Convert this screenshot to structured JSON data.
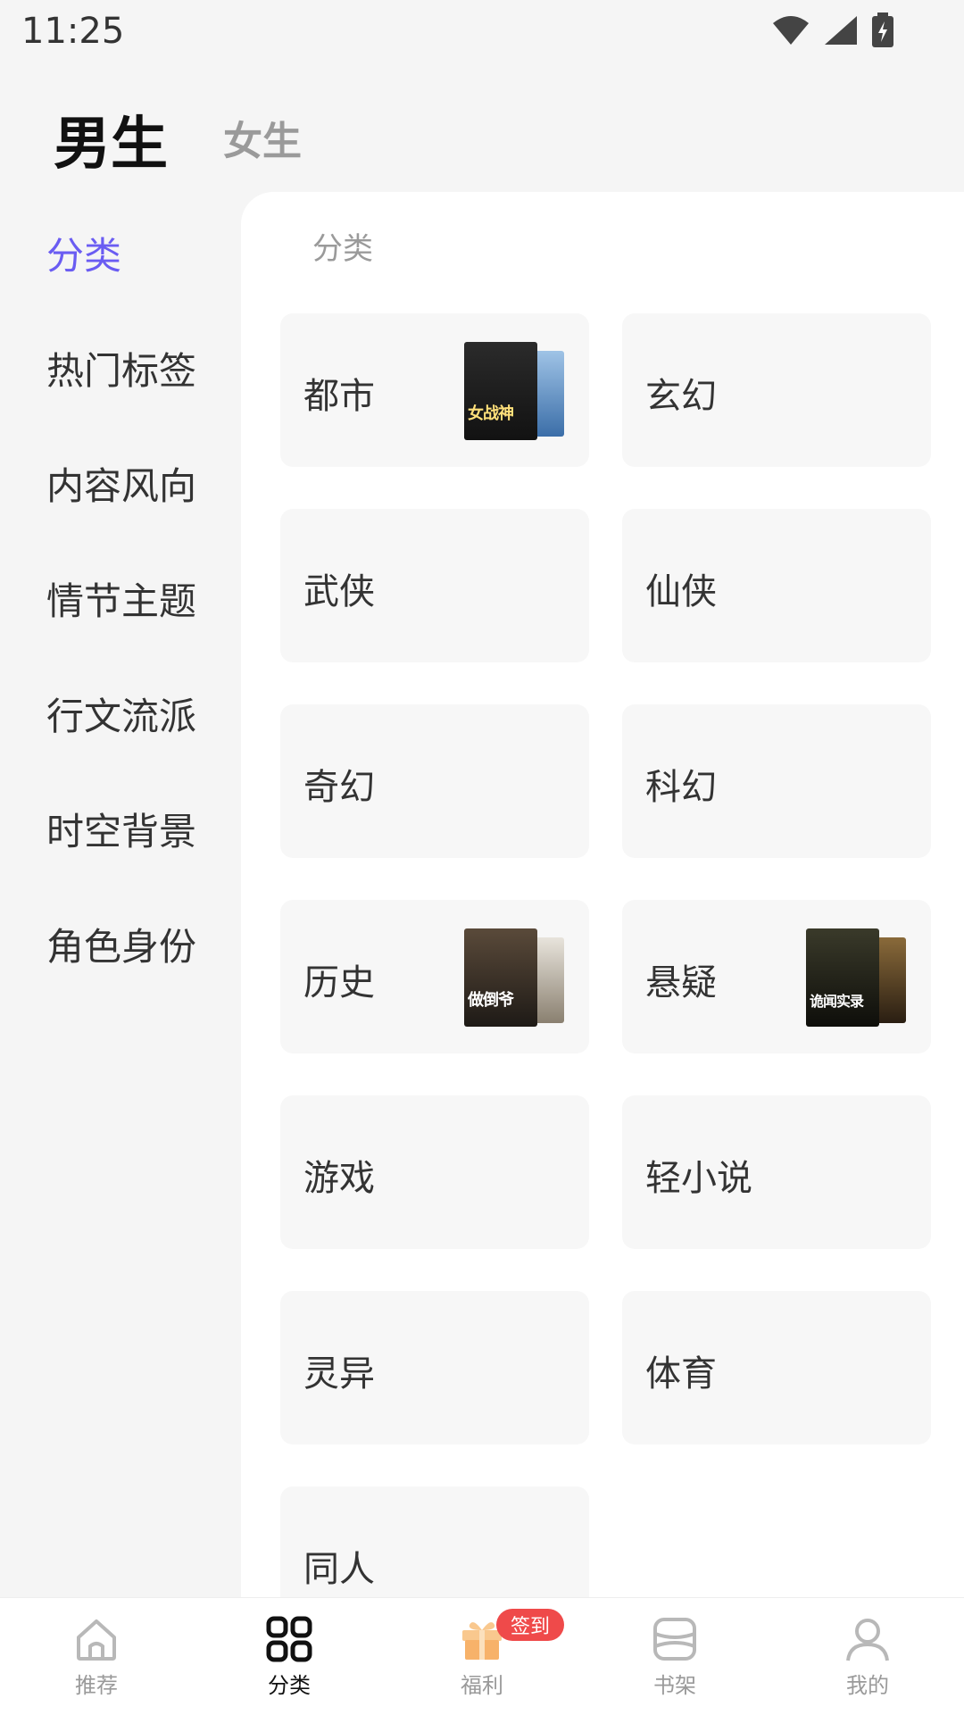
{
  "status": {
    "time": "11:25"
  },
  "gender_tabs": {
    "male": "男生",
    "female": "女生",
    "active": "male"
  },
  "sidebar": {
    "items": [
      {
        "label": "分类",
        "active": true
      },
      {
        "label": "热门标签"
      },
      {
        "label": "内容风向"
      },
      {
        "label": "情节主题"
      },
      {
        "label": "行文流派"
      },
      {
        "label": "时空背景"
      },
      {
        "label": "角色身份"
      }
    ]
  },
  "main": {
    "section_title": "分类",
    "categories": [
      {
        "label": "都市",
        "cover": "女战神"
      },
      {
        "label": "玄幻"
      },
      {
        "label": "武侠"
      },
      {
        "label": "仙侠"
      },
      {
        "label": "奇幻"
      },
      {
        "label": "科幻"
      },
      {
        "label": "历史",
        "cover": "做倒爷"
      },
      {
        "label": "悬疑",
        "cover": "诡闻实录"
      },
      {
        "label": "游戏"
      },
      {
        "label": "轻小说"
      },
      {
        "label": "灵异"
      },
      {
        "label": "体育"
      },
      {
        "label": "同人"
      }
    ]
  },
  "bottom_nav": {
    "items": [
      {
        "label": "推荐",
        "icon": "home-icon"
      },
      {
        "label": "分类",
        "icon": "grid-icon",
        "active": true
      },
      {
        "label": "福利",
        "icon": "gift-icon",
        "badge": "签到"
      },
      {
        "label": "书架",
        "icon": "bookshelf-icon"
      },
      {
        "label": "我的",
        "icon": "profile-icon"
      }
    ]
  },
  "colors": {
    "accent": "#6a5cf2",
    "badge": "#ef4a4a",
    "gift": "#f7b26a"
  }
}
